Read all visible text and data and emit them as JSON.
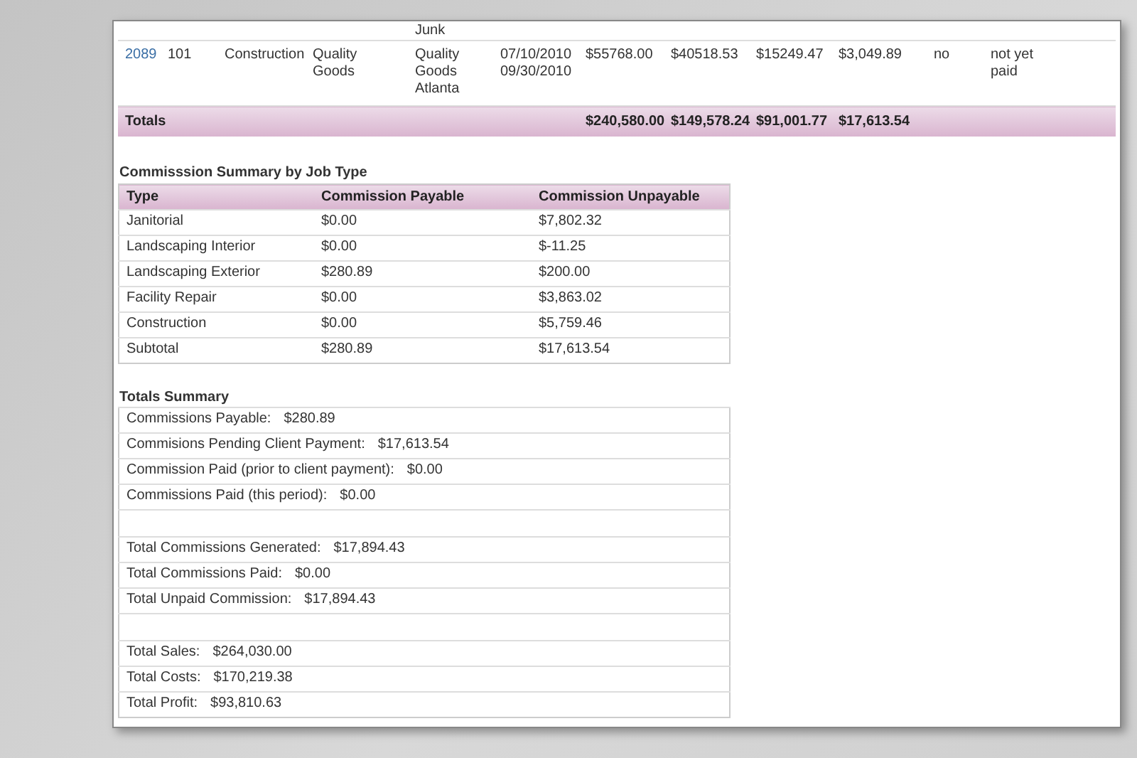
{
  "job_table": {
    "partial_row": {
      "column_5": "Junk"
    },
    "row": {
      "id": "2089",
      "cells": [
        "101",
        "Construction",
        "Quality Goods",
        "Quality Goods Atlanta",
        "07/10/2010 09/30/2010",
        "$55768.00",
        "$40518.53",
        "$15249.47",
        "$3,049.89",
        "no",
        "not yet paid"
      ]
    },
    "totals": {
      "label": "Totals",
      "values": [
        "$240,580.00",
        "$149,578.24",
        "$91,001.77",
        "$17,613.54"
      ]
    }
  },
  "commission_summary": {
    "title": "Commisssion Summary by Job Type",
    "columns": [
      "Type",
      "Commission Payable",
      "Commission Unpayable"
    ],
    "rows": [
      [
        "Janitorial",
        "$0.00",
        "$7,802.32"
      ],
      [
        "Landscaping Interior",
        "$0.00",
        "$-11.25"
      ],
      [
        "Landscaping Exterior",
        "$280.89",
        "$200.00"
      ],
      [
        "Facility Repair",
        "$0.00",
        "$3,863.02"
      ],
      [
        "Construction",
        "$0.00",
        "$5,759.46"
      ],
      [
        "Subtotal",
        "$280.89",
        "$17,613.54"
      ]
    ]
  },
  "totals_summary": {
    "title": "Totals Summary",
    "rows": [
      {
        "kind": "line",
        "label": "Commissions Payable:",
        "value": "$280.89"
      },
      {
        "kind": "line",
        "label": "Commisions Pending Client Payment:",
        "value": "$17,613.54"
      },
      {
        "kind": "line",
        "label": "Commission Paid (prior to client payment):",
        "value": "$0.00"
      },
      {
        "kind": "line",
        "label": "Commissions Paid (this period):",
        "value": "$0.00"
      },
      {
        "kind": "blank"
      },
      {
        "kind": "line",
        "label": "Total Commissions Generated:",
        "value": "$17,894.43"
      },
      {
        "kind": "line",
        "label": "Total Commissions Paid:",
        "value": "$0.00"
      },
      {
        "kind": "line",
        "label": "Total Unpaid Commission:",
        "value": "$17,894.43"
      },
      {
        "kind": "blank"
      },
      {
        "kind": "line",
        "label": "Total Sales:",
        "value": "$264,030.00"
      },
      {
        "kind": "line",
        "label": "Total Costs:",
        "value": "$170,219.38"
      },
      {
        "kind": "line",
        "label": "Total Profit:",
        "value": "$93,810.63"
      }
    ]
  }
}
